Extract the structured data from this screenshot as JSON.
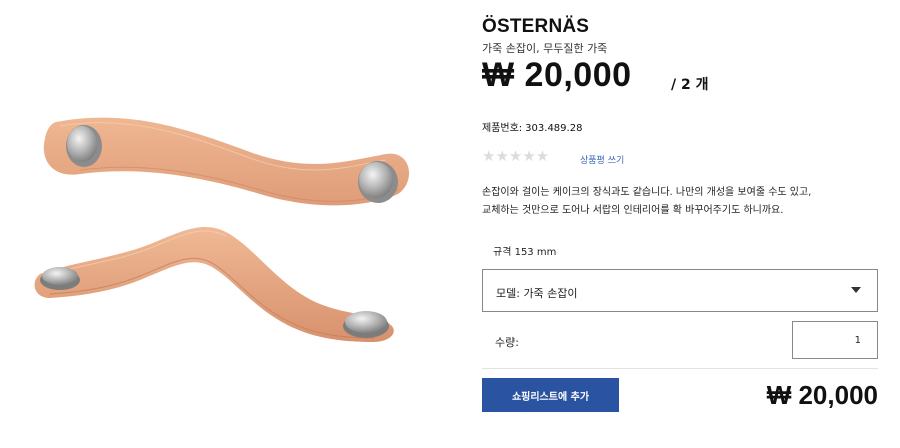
{
  "product": {
    "name": "ÖSTERNÄS",
    "subtitle": "가죽 손잡이, 무두질한 가죽",
    "price": "₩ 20,000",
    "price_unit": "/ 2 개",
    "article_label": "제품번호:",
    "article_number": "303.489.28",
    "stars": "★★★★★",
    "review_link": "상품평 쓰기",
    "description_line1": "손잡이와 걸이는 케이크의 장식과도 같습니다. 나만의 개성을 보여줄 수도 있고,",
    "description_line2": "교체하는 것만으로 도어나 서랍의 인테리어를 확 바꾸어주기도 하니까요.",
    "size": "규격 153 mm",
    "model_select": "모델: 가죽 손잡이",
    "quantity_label": "수량:",
    "quantity_value": "1",
    "add_button": "쇼핑리스트에 추가",
    "total_price": "₩ 20,000"
  },
  "colors": {
    "leather": "#e8a783",
    "button": "#2a53a1",
    "link": "#3a6ab4"
  }
}
